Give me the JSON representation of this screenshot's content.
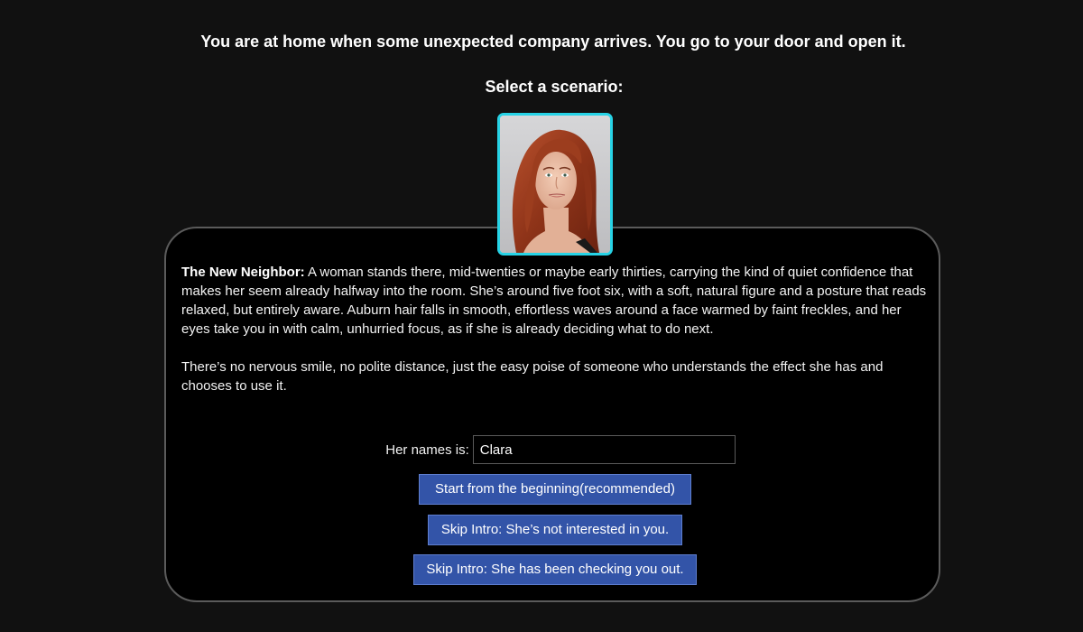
{
  "intro_text": "You are at home when some unexpected company arrives. You go to your door and open it.",
  "select_title": "Select a scenario:",
  "scenario": {
    "title": "The New Neighbor:",
    "paragraph1": " A woman stands there, mid-twenties or maybe early thirties, carrying the kind of quiet confidence that makes her seem already halfway into the room. She’s around five foot six, with a soft, natural figure and a posture that reads relaxed, but entirely aware. Auburn hair falls in smooth, effortless waves around a face warmed by faint freckles, and her eyes take you in with calm, unhurried focus, as if she is already deciding what to do next.",
    "paragraph2": "There’s no nervous smile, no polite distance, just the easy poise of someone who understands the effect she has and chooses to use it."
  },
  "name_form": {
    "label": "Her names is:",
    "value": "Clara"
  },
  "buttons": {
    "start": "Start from the beginning(recommended)",
    "skip_not_interested": "Skip Intro: She’s not interested in you.",
    "skip_checking_out": "Skip Intro: She has been checking you out."
  },
  "colors": {
    "background": "#111111",
    "portrait_border": "#27d3e6",
    "button": "#3354a8",
    "card_border": "#5b5b5b"
  }
}
